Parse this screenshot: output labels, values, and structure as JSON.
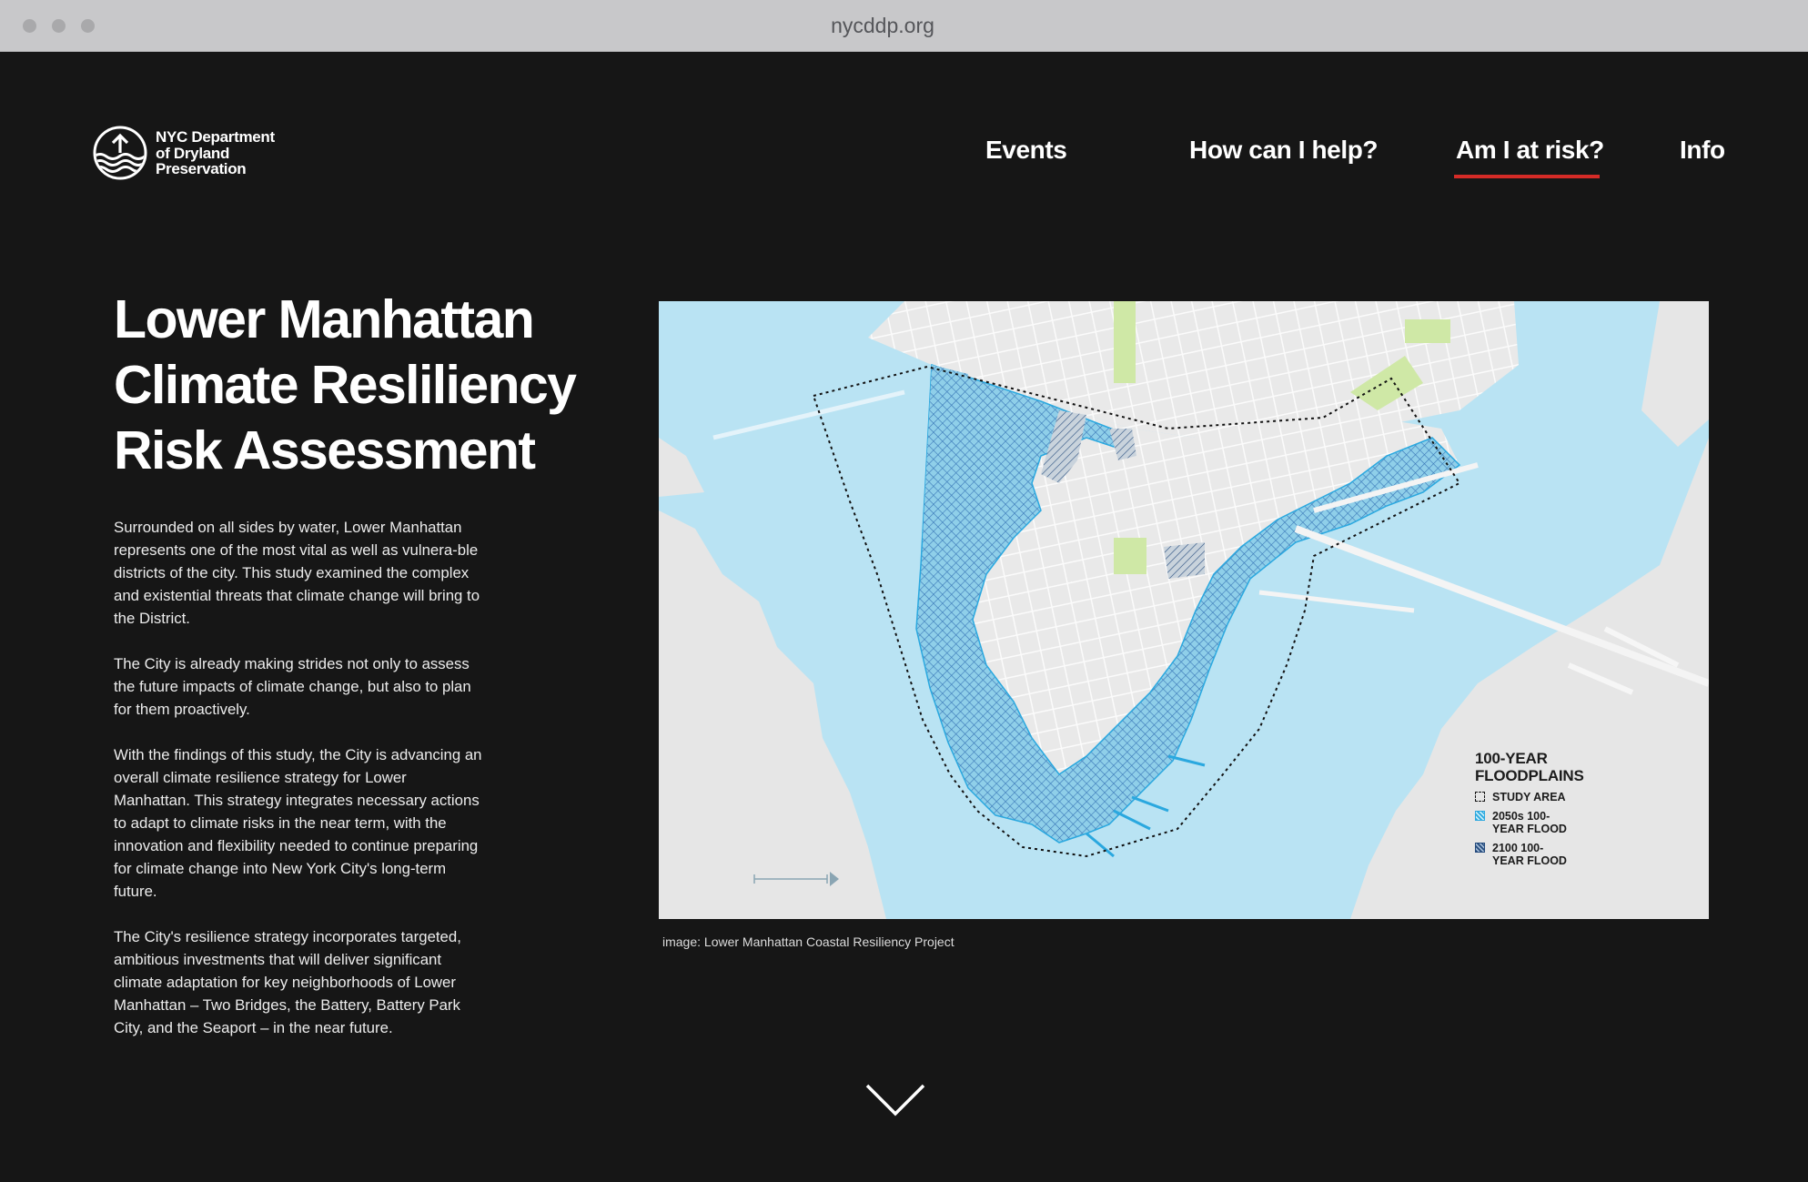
{
  "browser": {
    "url": "nycddp.org"
  },
  "header": {
    "logo_lines": [
      "NYC Department",
      "of Dryland",
      "Preservation"
    ],
    "nav": [
      {
        "label": "Events"
      },
      {
        "label": "How can I help?"
      },
      {
        "label": "Am I at risk?",
        "active": true
      },
      {
        "label": "Info"
      }
    ],
    "active_color": "#d52b27"
  },
  "article": {
    "headline_lines": [
      "Lower Manhattan",
      "Climate Resliliency",
      "Risk Assessment"
    ],
    "paragraphs": [
      "Surrounded on all sides by water, Lower Manhattan represents one of the most vital as well as vulnera-ble districts of the city. This study examined the complex and existential threats that climate change will bring to the District.",
      "The City is already making strides not only to assess the future impacts of climate change, but also to plan for them proactively.",
      "With the findings of this study, the City is advancing an overall climate resilience strategy for Lower Manhattan. This strategy integrates necessary actions to adapt to climate risks in the near term, with the innovation and flexibility needed to continue preparing for climate change into New York City's long-term future.",
      "The City's resilience strategy incorporates targeted, ambitious investments that will deliver significant climate adaptation for key neighborhoods of Lower Manhattan – Two Bridges, the Battery, Battery Park City, and the Seaport – in the near future."
    ]
  },
  "map": {
    "legend": {
      "title_lines": [
        "100-YEAR",
        "FLOODPLAINS"
      ],
      "items": [
        {
          "lines": [
            "STUDY AREA"
          ]
        },
        {
          "lines": [
            "2050s 100-",
            "YEAR FLOOD"
          ]
        },
        {
          "lines": [
            "2100 100-",
            "YEAR FLOOD"
          ]
        }
      ]
    },
    "colors": {
      "water": "#b9e3f3",
      "land": "#e9e9e9",
      "park": "#cfe8a6",
      "flood_2050s": "#2aa8df",
      "flood_2100": "#244a7c"
    },
    "caption": "image: Lower Manhattan Coastal Resiliency Project"
  },
  "scroll": {
    "icon": "chevron-down-icon"
  }
}
